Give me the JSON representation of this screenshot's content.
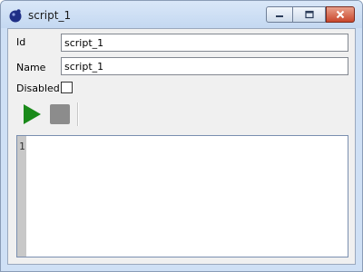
{
  "window": {
    "title": "script_1",
    "icons": {
      "app": "app-dot-icon",
      "minimize": "minimize-icon",
      "maximize": "maximize-icon",
      "close": "close-icon"
    },
    "close_color": "#c9472c"
  },
  "form": {
    "id_label": "Id",
    "id_value": "script_1",
    "name_label": "Name",
    "name_value": "script_1",
    "disabled_label": "Disabled",
    "disabled_checked": false
  },
  "toolbar": {
    "run_icon": "play-icon",
    "run_color": "#1a8a1a",
    "stop_icon": "stop-icon"
  },
  "editor": {
    "line_numbers": [
      "1"
    ],
    "content": ""
  }
}
